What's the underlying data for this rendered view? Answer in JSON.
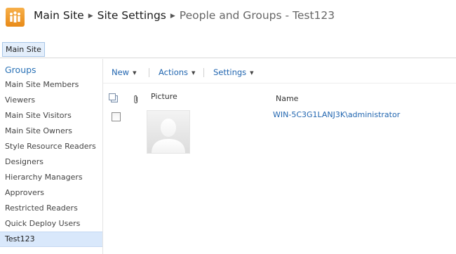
{
  "breadcrumb": {
    "site": "Main Site",
    "settings": "Site Settings",
    "page": "People and Groups - Test123",
    "separator": "▶"
  },
  "topnav": {
    "tab": "Main Site"
  },
  "sidebar": {
    "heading": "Groups",
    "items": [
      {
        "label": "Main Site Members"
      },
      {
        "label": "Viewers"
      },
      {
        "label": "Main Site Visitors"
      },
      {
        "label": "Main Site Owners"
      },
      {
        "label": "Style Resource Readers"
      },
      {
        "label": "Designers"
      },
      {
        "label": "Hierarchy Managers"
      },
      {
        "label": "Approvers"
      },
      {
        "label": "Restricted Readers"
      },
      {
        "label": "Quick Deploy Users"
      },
      {
        "label": "Test123"
      }
    ],
    "selected": "Test123"
  },
  "toolbar": {
    "new_label": "New",
    "actions_label": "Actions",
    "settings_label": "Settings",
    "arrow": "▼"
  },
  "list": {
    "columns": {
      "picture": "Picture",
      "name": "Name"
    },
    "rows": [
      {
        "name": "WIN-5C3G1LANJ3K\\administrator"
      }
    ]
  },
  "icons": {
    "site_logo": "site-logo-icon",
    "attachment": "paperclip-icon",
    "select_all": "select-all-icon",
    "placeholder_photo": "person-silhouette-icon"
  },
  "colors": {
    "link": "#2266b0",
    "accent_orange": "#e88a17",
    "selected_bg": "#d9e8fb"
  }
}
